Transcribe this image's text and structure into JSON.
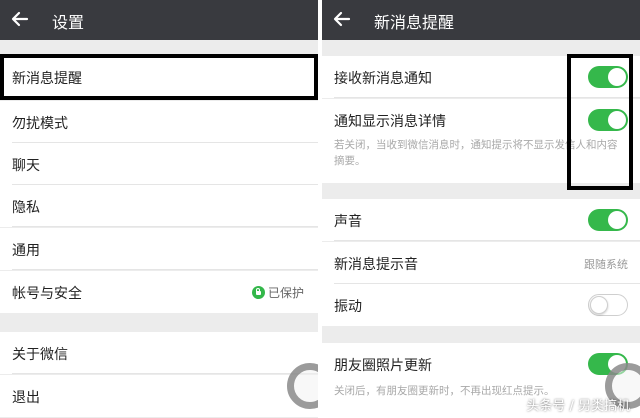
{
  "left": {
    "title": "设置",
    "items": [
      {
        "label": "新消息提醒"
      },
      {
        "label": "勿扰模式"
      },
      {
        "label": "聊天"
      },
      {
        "label": "隐私"
      },
      {
        "label": "通用"
      },
      {
        "label": "帐号与安全",
        "badge": "已保护"
      },
      {
        "label": "关于微信"
      },
      {
        "label": "退出"
      }
    ]
  },
  "right": {
    "title": "新消息提醒",
    "items": [
      {
        "label": "接收新消息通知",
        "toggle": true
      },
      {
        "label": "通知显示消息详情",
        "toggle": true
      },
      {
        "label": "声音",
        "toggle": true
      },
      {
        "label": "新消息提示音",
        "value": "跟随系统"
      },
      {
        "label": "振动",
        "toggle": false
      },
      {
        "label": "朋友圈照片更新",
        "toggle": true
      }
    ],
    "hint_details": "若关闭，当收到微信消息时，通知提示将不显示发信人和内容摘要。",
    "hint_moments": "关闭后，有朋友圈更新时，不再出现红点提示。"
  },
  "watermark": "头条号 / 另类搞机",
  "colors": {
    "topbar": "#393a3f",
    "toggle_on": "#35b84b",
    "background": "#ececec",
    "lock": "#33b74a"
  }
}
